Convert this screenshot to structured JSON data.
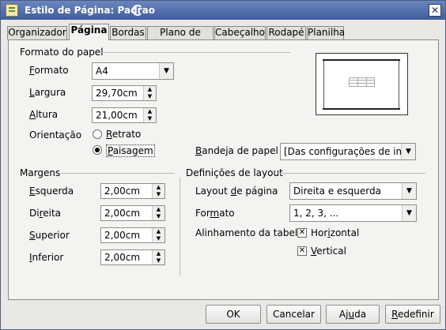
{
  "window": {
    "title": "Estilo de Página: Padrao",
    "close_glyph": "✕",
    "title_icon": "document-style-icon"
  },
  "tabs": [
    "Organizador",
    "Página",
    "Bordas",
    "Plano de fundo",
    "Cabeçalho",
    "Rodapé",
    "Planilha"
  ],
  "paper_format": {
    "title": "Formato do papel",
    "format_label": "Formato",
    "format_value": "A4",
    "width_label": "Largura",
    "width_value": "29,70cm",
    "height_label": "Altura",
    "height_value": "21,00cm",
    "orientation_label": "Orientação",
    "portrait_label": "Retrato",
    "landscape_label": "Paisagem",
    "selected_orientation": "Paisagem",
    "tray_label": "Bandeja de papel",
    "tray_value": "[Das configurações de impr"
  },
  "margins": {
    "title": "Margens",
    "left_label": "Esquerda",
    "left_value": "2,00cm",
    "right_label": "Direita",
    "right_value": "2,00cm",
    "top_label": "Superior",
    "top_value": "2,00cm",
    "bottom_label": "Inferior",
    "bottom_value": "2,00cm"
  },
  "layout": {
    "title": "Definições de layout",
    "page_layout_label": "Layout de página",
    "page_layout_value": "Direita e esquerda",
    "format_label": "Formato",
    "format_value": "1, 2, 3, ...",
    "align_label": "Alinhamento da tabela",
    "horizontal_label": "Horizontal",
    "vertical_label": "Vertical",
    "horizontal_checked": true,
    "vertical_checked": true
  },
  "buttons": {
    "ok": "OK",
    "cancel": "Cancelar",
    "help": "Ajuda",
    "reset": "Redefinir"
  }
}
